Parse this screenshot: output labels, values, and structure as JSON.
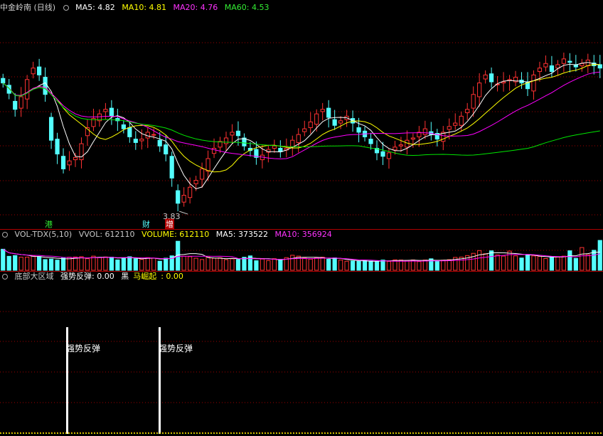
{
  "main_header": {
    "title": "中金岭南 (日线)",
    "ma5": "MA5: 4.82",
    "ma10": "MA10: 4.81",
    "ma20": "MA20: 4.76",
    "ma60": "MA60: 4.53"
  },
  "vol_header": {
    "name": "VOL-TDX(5,10)",
    "vvol": "VVOL: 612110",
    "volume": "VOLUME: 612110",
    "ma5": "MA5: 373522",
    "ma10": "MA10: 356924"
  },
  "ind_header": {
    "name": "底部大区域",
    "s1": "强势反弹: 0.00",
    "s2_prefix": "黑",
    "s2_mid": "马崛起",
    "s2_suffix": ": 0.00"
  },
  "markers": {
    "gang": "港",
    "cai": "财",
    "zeng": "增"
  },
  "low_label": "3.83",
  "signal_label": "强势反弹",
  "colors": {
    "up": "#ff3232",
    "down": "#54ffff",
    "ma5": "#ffffff",
    "ma10": "#ffff00",
    "ma20": "#ff00ff",
    "ma60": "#00e600",
    "grid": "#a00000"
  },
  "chart_data": {
    "type": "candlestick",
    "title": "中金岭南 (日线)",
    "min_low": 3.83,
    "ma_last": {
      "MA5": 4.82,
      "MA10": 4.81,
      "MA20": 4.76,
      "MA60": 4.53
    },
    "volume_last": 612110,
    "volume_ma_last": {
      "MA5": 373522,
      "MA10": 356924
    },
    "signal_positions": [
      12,
      30
    ],
    "close": [
      4.95,
      4.86,
      4.72,
      4.83,
      4.98,
      5.08,
      5.02,
      4.85,
      4.45,
      4.33,
      4.2,
      4.27,
      4.3,
      4.42,
      4.56,
      4.64,
      4.68,
      4.72,
      4.66,
      4.62,
      4.55,
      4.48,
      4.43,
      4.46,
      4.52,
      4.5,
      4.4,
      4.33,
      4.12,
      3.9,
      3.97,
      4.04,
      4.1,
      4.2,
      4.29,
      4.38,
      4.44,
      4.47,
      4.52,
      4.49,
      4.4,
      4.36,
      4.3,
      4.32,
      4.37,
      4.4,
      4.35,
      4.38,
      4.45,
      4.5,
      4.55,
      4.61,
      4.68,
      4.72,
      4.65,
      4.58,
      4.62,
      4.66,
      4.6,
      4.52,
      4.48,
      4.42,
      4.34,
      4.31,
      4.34,
      4.39,
      4.41,
      4.45,
      4.47,
      4.52,
      4.55,
      4.5,
      4.46,
      4.52,
      4.57,
      4.6,
      4.66,
      4.72,
      4.85,
      4.95,
      5.02,
      4.96,
      4.94,
      4.96,
      4.98,
      5.0,
      4.95,
      4.9,
      5.02,
      5.08,
      5.12,
      5.05,
      5.11,
      5.16,
      5.13,
      5.09,
      5.12,
      5.15,
      5.1,
      5.08
    ],
    "volume": [
      432000,
      286000,
      302000,
      268000,
      270000,
      295000,
      281000,
      220000,
      230000,
      208000,
      250000,
      268000,
      272000,
      279000,
      238000,
      290000,
      262000,
      273000,
      269000,
      212000,
      257000,
      278000,
      237000,
      223000,
      259000,
      248000,
      186000,
      248000,
      296000,
      595000,
      289000,
      279000,
      247000,
      220000,
      269000,
      247000,
      256000,
      218000,
      235000,
      219000,
      267000,
      295000,
      196000,
      230000,
      199000,
      238000,
      216000,
      259000,
      308000,
      290000,
      250000,
      229000,
      258000,
      269000,
      225000,
      255000,
      210000,
      186000,
      189000,
      185000,
      198000,
      190000,
      183000,
      210000,
      180000,
      215000,
      210000,
      201000,
      212000,
      179000,
      210000,
      236000,
      184000,
      208000,
      218000,
      264000,
      270000,
      301000,
      347000,
      404000,
      339000,
      399000,
      316000,
      291000,
      393000,
      296000,
      252000,
      323000,
      294000,
      285000,
      241000,
      284000,
      270000,
      290000,
      400000,
      245000,
      466000,
      321000,
      410000,
      612110
    ],
    "ma5_volume": [
      432000,
      359000,
      340000,
      322000,
      312000,
      284000,
      283000,
      267000,
      259000,
      247000,
      238000,
      235000,
      246000,
      255000,
      249000,
      261000,
      268000,
      268000,
      266000,
      251000,
      254000,
      258000,
      251000,
      235000,
      243000,
      249000,
      231000,
      233000,
      247000,
      315000,
      323000,
      341000,
      341000,
      326000,
      261000,
      252000,
      248000,
      238000,
      245000,
      235000,
      239000,
      249000,
      244000,
      241000,
      237000,
      226000,
      216000,
      228000,
      244000,
      262000,
      265000,
      267000,
      267000,
      259000,
      244000,
      246000,
      243000,
      221000,
      208000,
      197000,
      194000,
      187000,
      187000,
      194000,
      192000,
      198000,
      202000,
      202000,
      207000,
      203000,
      202000,
      208000,
      204000,
      206000,
      210000,
      222000,
      234000,
      254000,
      280000,
      317000,
      332000,
      358000,
      361000,
      359000,
      350000,
      343000,
      330000,
      314000,
      312000,
      290000,
      281000,
      271000,
      274000,
      274000,
      298000,
      298000,
      333000,
      341000,
      369000,
      373522
    ],
    "ma10_volume": [
      432000,
      359000,
      340000,
      322000,
      312000,
      305000,
      305000,
      293000,
      290000,
      281000,
      264000,
      262000,
      259000,
      259000,
      250000,
      258000,
      260000,
      263000,
      267000,
      259000,
      261000,
      262000,
      258000,
      253000,
      255000,
      250000,
      242000,
      239000,
      241000,
      284000,
      287000,
      287000,
      288000,
      288000,
      289000,
      286000,
      287000,
      284000,
      278000,
      240000,
      238000,
      240000,
      235000,
      236000,
      229000,
      228000,
      224000,
      228000,
      236000,
      243000,
      241000,
      237000,
      244000,
      248000,
      250000,
      251000,
      245000,
      238000,
      226000,
      216000,
      211000,
      207000,
      200000,
      194000,
      190000,
      186000,
      186000,
      187000,
      189000,
      188000,
      189000,
      194000,
      194000,
      193000,
      197000,
      202000,
      208000,
      218000,
      231000,
      253000,
      266000,
      283000,
      296000,
      304000,
      321000,
      324000,
      322000,
      324000,
      319000,
      307000,
      297000,
      286000,
      281000,
      281000,
      281000,
      276000,
      297000,
      298000,
      309000,
      341000
    ]
  }
}
